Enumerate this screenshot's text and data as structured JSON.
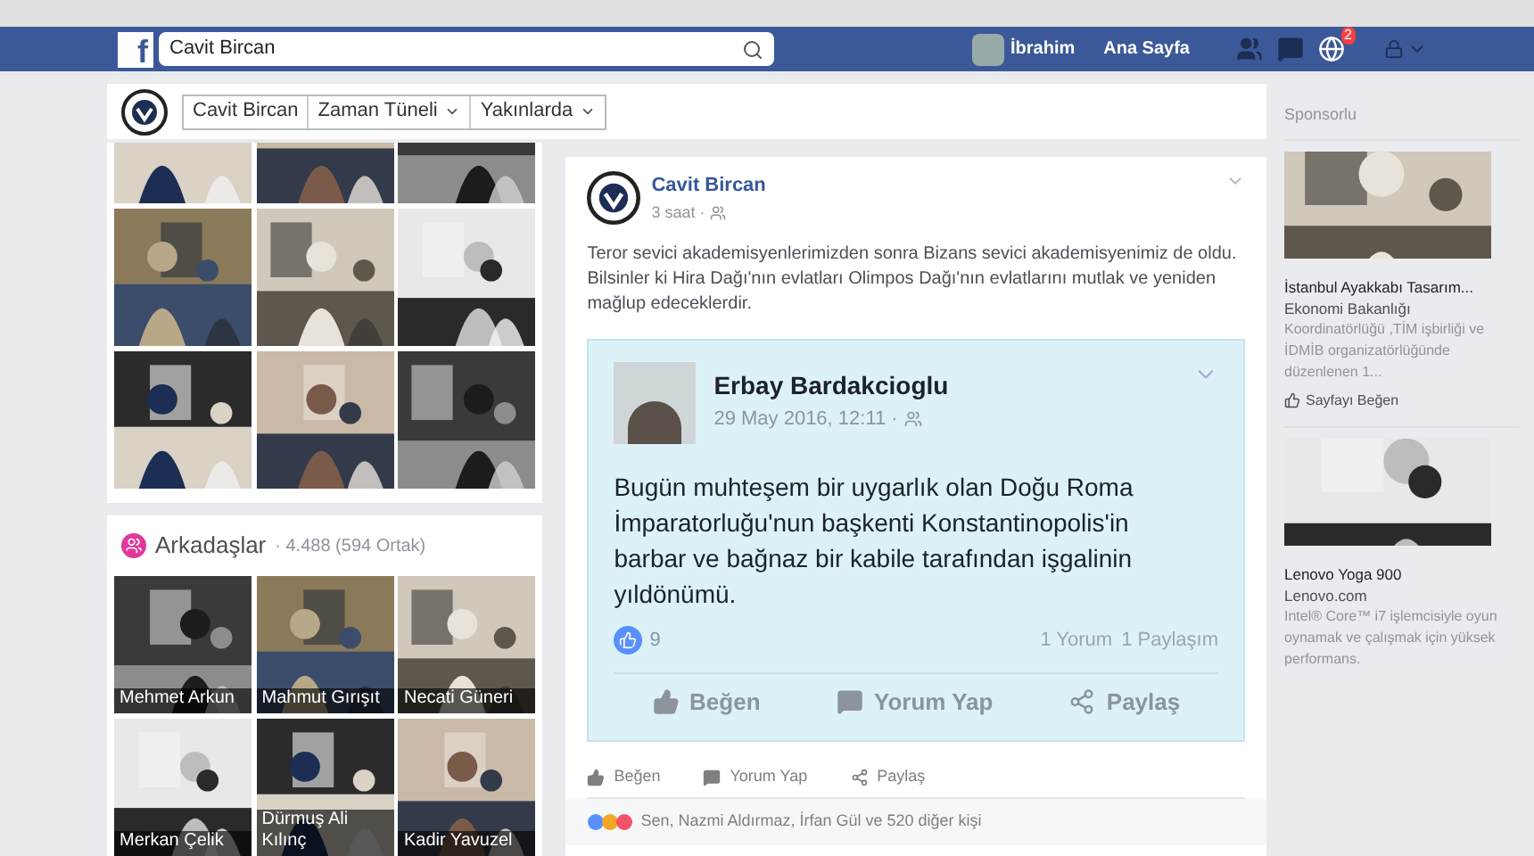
{
  "topbar": {
    "logo": "f",
    "search": "Cavit Bircan",
    "user": "İbrahim",
    "home": "Ana Sayfa",
    "notification_count": "2"
  },
  "profile_nav": {
    "name": "Cavit Bircan",
    "tabs": [
      {
        "label": "Zaman Tüneli"
      },
      {
        "label": "Yakınlarda"
      }
    ]
  },
  "friends": {
    "title": "Arkadaşlar",
    "count": "· 4.488 (594 Ortak)",
    "items": [
      {
        "name": "Mehmet Arkun"
      },
      {
        "name": "Mahmut Gırışıt"
      },
      {
        "name": "Necati Güneri"
      },
      {
        "name": "Merkan Çelik"
      },
      {
        "name": "Dürmuş Ali Kılınç"
      },
      {
        "name": "Kadir Yavuzel"
      }
    ]
  },
  "post": {
    "author": "Cavit Bircan",
    "time": "3 saat ·",
    "text": "Teror sevici akademisyenlerimizden sonra Bizans sevici akademisyenimiz de oldu. Bilsinler ki Hira Dağı'nın evlatları Olimpos Dağı'nın evlatlarını mutlak ve yeniden mağlup edeceklerdir.",
    "shared": {
      "author": "Erbay Bardakcioglu",
      "date": "29 May 2016, 12:11 ·",
      "text": "Bugün muhteşem bir uygarlık olan Doğu Roma İmparatorluğu'nun başkenti Konstantinopolis'in barbar ve bağnaz bir kabile tarafından işgalinin yıldönümü.",
      "likes": "9",
      "comments": "1 Yorum",
      "shares": "1 Paylaşım",
      "actions": [
        {
          "kind": "like",
          "label": "Beğen"
        },
        {
          "kind": "comment",
          "label": "Yorum Yap"
        },
        {
          "kind": "share",
          "label": "Paylaş"
        }
      ]
    },
    "actions": [
      {
        "kind": "like",
        "label": "Beğen"
      },
      {
        "kind": "comment",
        "label": "Yorum Yap"
      },
      {
        "kind": "share",
        "label": "Paylaş"
      }
    ],
    "reactions": "Sen, Nazmi Aldırmaz, İrfan Gül ve 520 diğer kişi"
  },
  "sponsored": {
    "title": "Sponsorlu",
    "ads": [
      {
        "title": "İstanbul Ayakkabı Tasarım...",
        "lead": "Ekonomi Bakanlığı",
        "text": "Koordinatörlüğü ,TİM işbirliği ve İDMİB organizatörlüğünde düzenlenen 1...",
        "like": "Sayfayı Beğen"
      },
      {
        "title": "Lenovo Yoga 900",
        "lead": "Lenovo.com",
        "text": "Intel® Core™ i7 işlemcisiyle oyun oynamak ve çalışmak için yüksek performans."
      }
    ]
  }
}
